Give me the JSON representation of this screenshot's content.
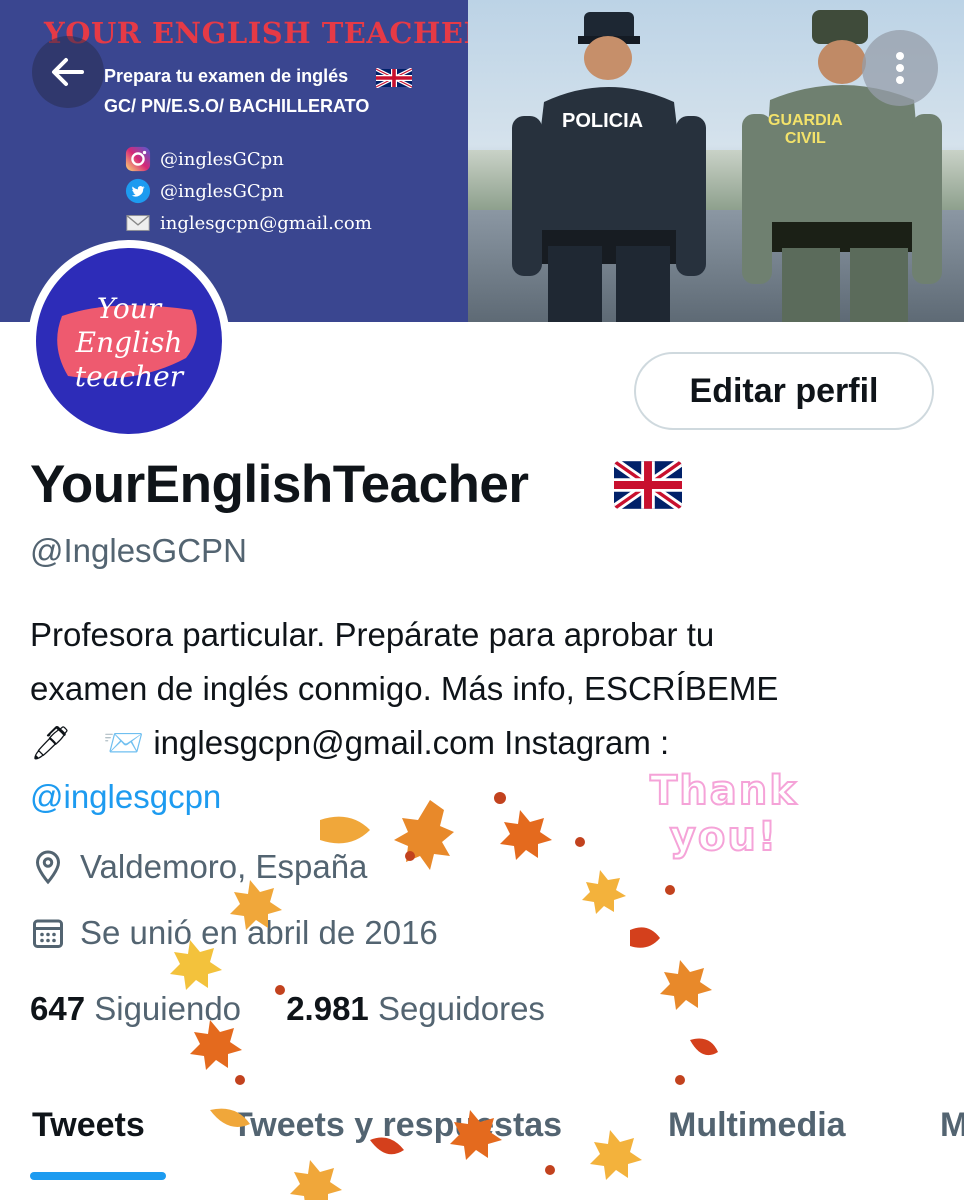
{
  "banner": {
    "title": "YOUR ENGLISH TEACHER",
    "subtitle_line1": "Prepara tu examen de inglés",
    "subtitle_line2": "GC/ PN/E.S.O/ BACHILLERATO",
    "instagram": "@inglesGCpn",
    "twitter": "@inglesGCpn",
    "email": "inglesgcpn@gmail.com",
    "police_label": "POLICIA",
    "guardia_label_1": "GUARDIA",
    "guardia_label_2": "CIVIL"
  },
  "avatar": {
    "line1": "Your",
    "line2": "English",
    "line3": "teacher"
  },
  "header": {
    "back_icon": "arrow-left-icon",
    "more_icon": "more-vertical-icon"
  },
  "profile": {
    "edit_label": "Editar perfil",
    "display_name": "YourEnglishTeacher",
    "handle": "@InglesGCPN",
    "bio_line1": "Profesora particular. Prepárate para aprobar tu",
    "bio_line2": "examen de inglés conmigo.  Más info, ESCRÍBEME",
    "bio_line3_emoji1": "🖊",
    "bio_line3_emoji2": "📨",
    "bio_line3_text": "inglesgcpn@gmail.com  Instagram :",
    "bio_link": "@inglesgcpn",
    "location": "Valdemoro, España",
    "joined": "Se unió en abril de 2016"
  },
  "stats": {
    "following_count": "647",
    "following_label": "Siguiendo",
    "followers_count": "2.981",
    "followers_label": "Seguidores"
  },
  "tabs": [
    {
      "label": "Tweets",
      "active": true
    },
    {
      "label": "Tweets y respuestas",
      "active": false
    },
    {
      "label": "Multimedia",
      "active": false
    },
    {
      "label": "M",
      "active": false
    }
  ],
  "overlay": {
    "thanks_line1": "Thank",
    "thanks_line2": "you!"
  },
  "colors": {
    "accent": "#1d9bf0",
    "banner_bg": "#3a4690",
    "banner_title": "#e63a46",
    "avatar_bg": "#2d2cb8",
    "muted": "#536471"
  }
}
